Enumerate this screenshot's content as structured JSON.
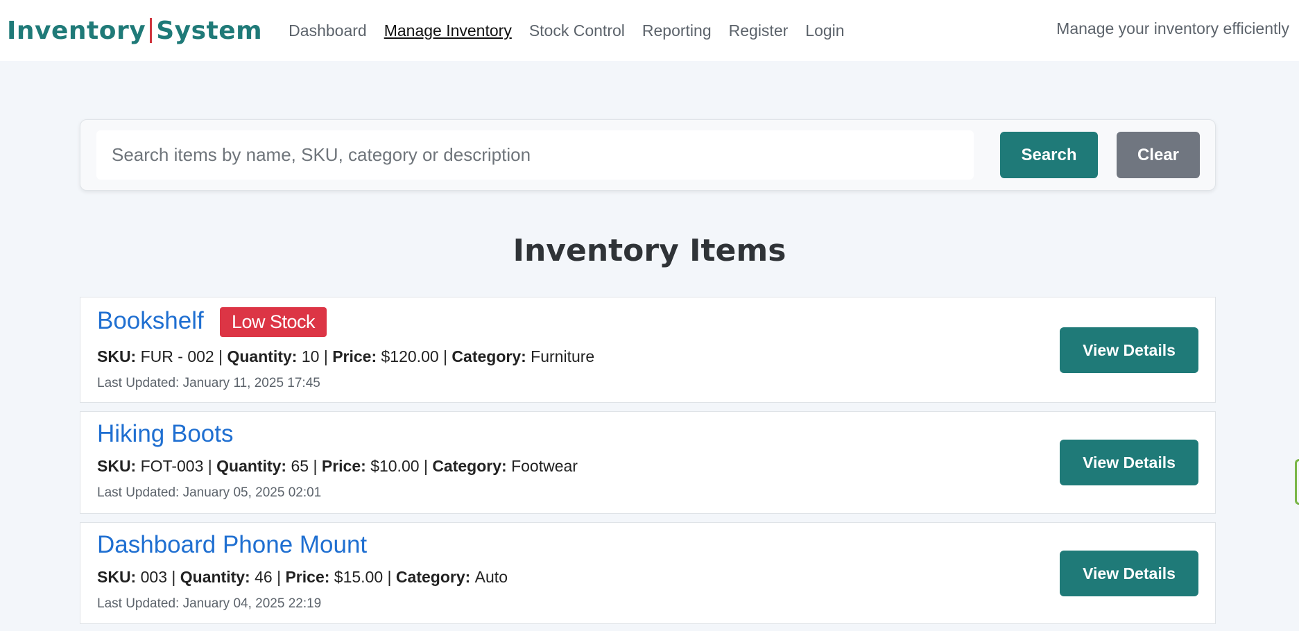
{
  "brand": {
    "part1": "Inventory",
    "part2": "System"
  },
  "nav": {
    "links": [
      "Dashboard",
      "Manage Inventory",
      "Stock Control",
      "Reporting",
      "Register",
      "Login"
    ],
    "active": "Manage Inventory"
  },
  "tagline": "Manage your inventory efficiently",
  "search": {
    "placeholder": "Search items by name, SKU, category or description",
    "value": "",
    "search_label": "Search",
    "clear_label": "Clear"
  },
  "page_title": "Inventory Items",
  "labels": {
    "sku": "SKU:",
    "quantity": "Quantity:",
    "price": "Price:",
    "category": "Category:",
    "separator": "|",
    "view_details": "View Details"
  },
  "items": [
    {
      "name": "Bookshelf",
      "badge": "Low Stock",
      "sku": "FUR - 002",
      "quantity": "10",
      "price": "$120.00",
      "category": "Furniture",
      "updated": "Last Updated: January 11, 2025 17:45"
    },
    {
      "name": "Hiking Boots",
      "badge": "",
      "sku": "FOT-003",
      "quantity": "65",
      "price": "$10.00",
      "category": "Footwear",
      "updated": "Last Updated: January 05, 2025 02:01"
    },
    {
      "name": "Dashboard Phone Mount",
      "badge": "",
      "sku": "003",
      "quantity": "46",
      "price": "$15.00",
      "category": "Auto",
      "updated": "Last Updated: January 04, 2025 22:19"
    }
  ],
  "colors": {
    "brand": "#1f7a78",
    "brand_separator": "#d0353e",
    "link": "#1f6fd1",
    "badge": "#dc3545",
    "clear_button": "#707680",
    "background": "#f3f6fa"
  }
}
